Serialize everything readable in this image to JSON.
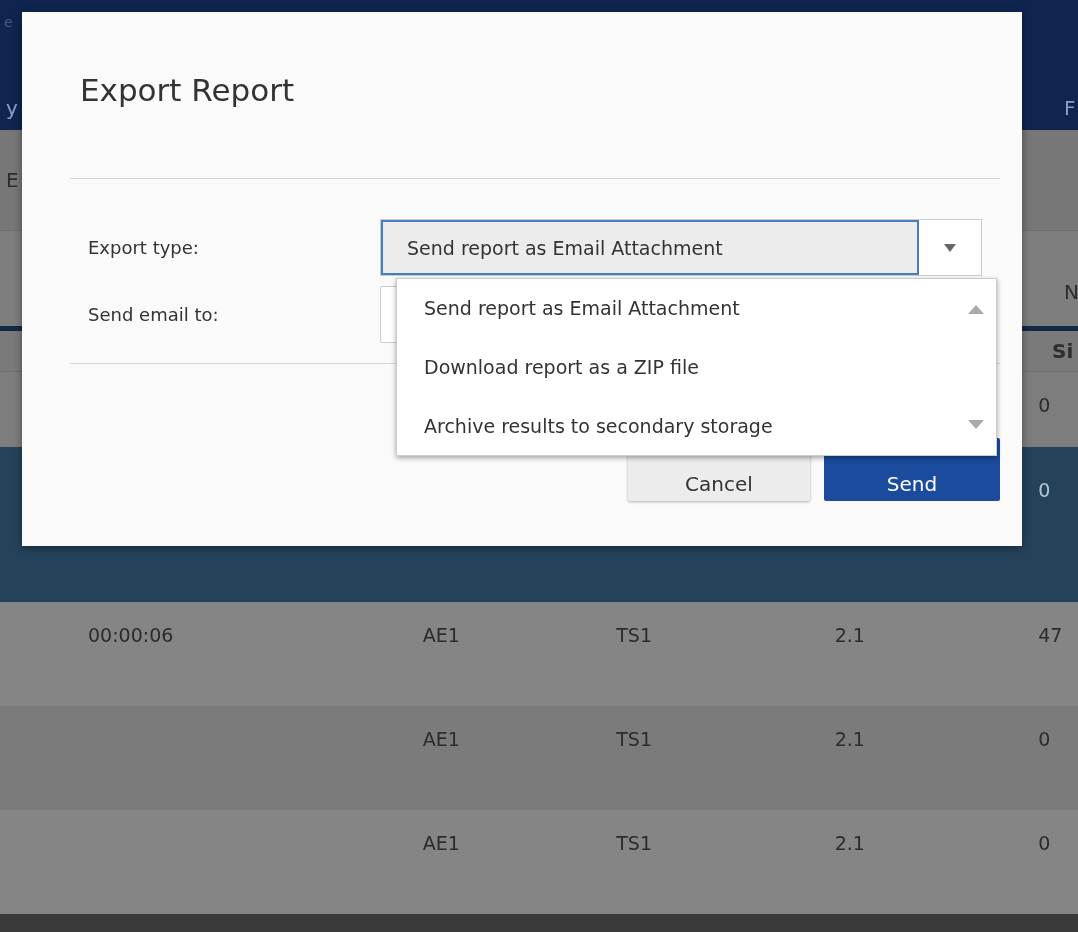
{
  "app_header": {
    "corner_text": "e",
    "left_text": "y",
    "right_text": "F"
  },
  "toolbar": {
    "left_text": "E"
  },
  "table": {
    "heading_fragments": [
      "N",
      "Si"
    ],
    "rows": [
      {
        "selected": false,
        "column_5": "0"
      },
      {
        "selected": true,
        "column_5": "0"
      },
      {
        "selected": false,
        "column_1": "00:00:06",
        "column_2": "AE1",
        "column_3": "TS1",
        "column_4": "2.1",
        "column_5": "47"
      },
      {
        "selected": false,
        "column_2": "AE1",
        "column_3": "TS1",
        "column_4": "2.1",
        "column_5": "0"
      },
      {
        "selected": false,
        "column_2": "AE1",
        "column_3": "TS1",
        "column_4": "2.1",
        "column_5": "0"
      }
    ]
  },
  "dialog": {
    "title": "Export Report",
    "fields": [
      {
        "kind": "select",
        "label": "Export type:",
        "value": "Send report as Email Attachment",
        "expanded": true,
        "options": [
          "Send report as Email Attachment",
          "Download report as a ZIP file",
          "Archive results to secondary storage"
        ]
      },
      {
        "kind": "text",
        "label": "Send email to:"
      }
    ],
    "buttons": [
      {
        "kind": "secondary",
        "label": "Cancel"
      },
      {
        "kind": "primary",
        "label": "Send"
      }
    ]
  }
}
